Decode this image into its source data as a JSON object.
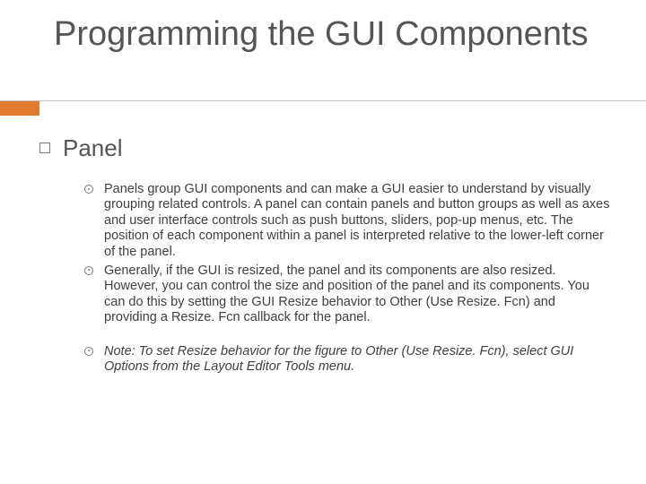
{
  "title": "Programming the GUI Components",
  "section": {
    "heading": "Panel",
    "bullets": [
      "Panels group GUI components and can make a GUI easier to understand by visually grouping related controls. A panel can contain panels and button groups as well as axes and user interface controls such as push buttons, sliders, pop-up menus, etc. The position of each component within a panel is interpreted relative to the lower-left corner of the panel.",
      "Generally, if the GUI is resized, the panel and its components are also resized. However, you can control the size and position of the panel and its components. You can do this by setting the GUI Resize behavior to Other (Use Resize. Fcn) and providing a Resize. Fcn callback for the panel.",
      "Note: To set Resize behavior for the figure to Other (Use Resize. Fcn), select GUI Options from the Layout Editor Tools menu."
    ]
  }
}
